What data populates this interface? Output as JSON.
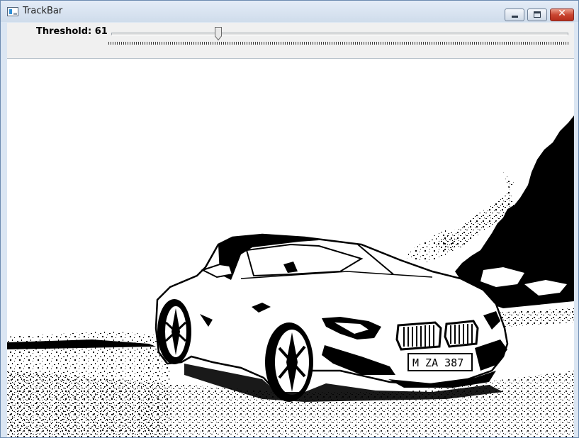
{
  "window": {
    "title": "TrackBar",
    "controls": {
      "minimize": "minimize",
      "maximize": "maximize",
      "close": "✕"
    }
  },
  "trackbar": {
    "label": "Threshold: 61",
    "value": 61,
    "min": 0,
    "max": 255
  },
  "image": {
    "plate_text": "M ZA 387"
  }
}
